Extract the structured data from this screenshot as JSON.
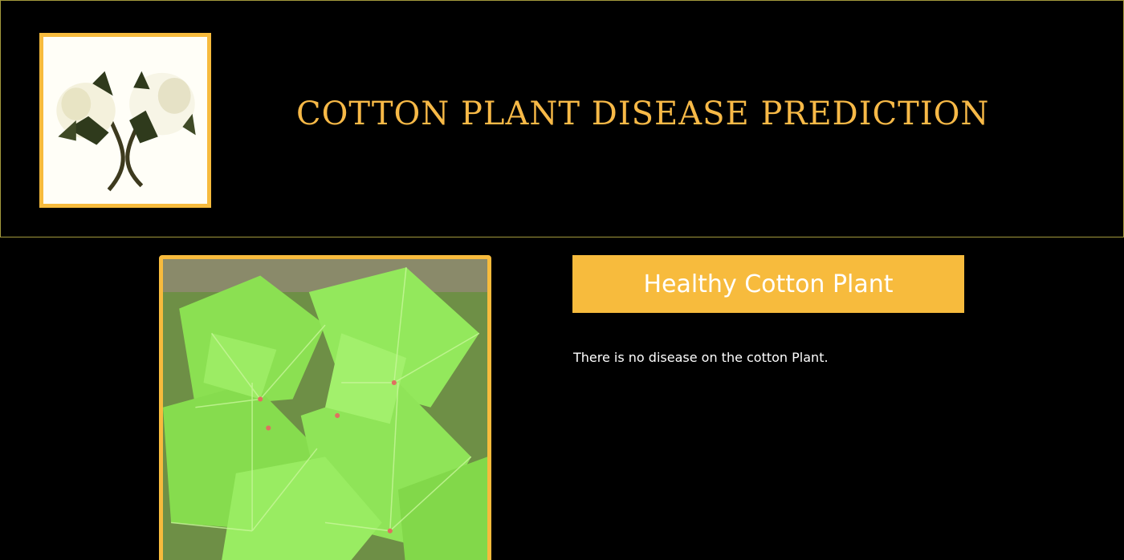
{
  "header": {
    "title": "COTTON PLANT DISEASE PREDICTION",
    "logo_icon": "cotton-boll-icon"
  },
  "result": {
    "label": "Healthy Cotton Plant",
    "description": "There is no disease on the cotton Plant."
  },
  "uploaded_image": {
    "icon": "cotton-leaf-photo"
  },
  "colors": {
    "accent": "#f7bb3d",
    "title": "#f7b947",
    "background": "#000000",
    "text": "#ffffff",
    "leaf": "#7fd64a"
  }
}
